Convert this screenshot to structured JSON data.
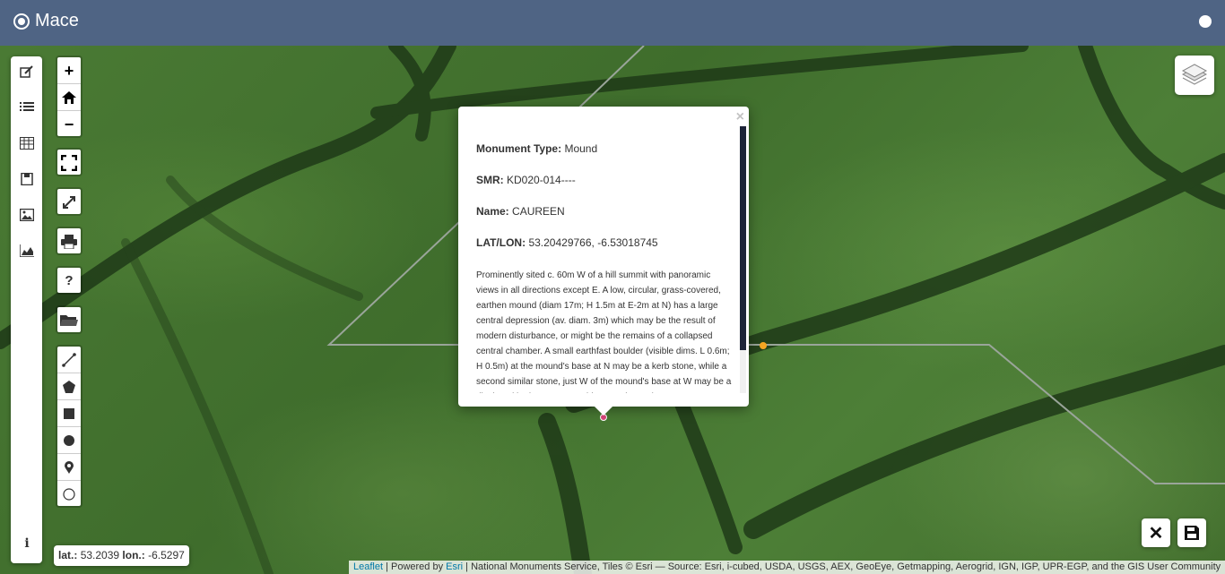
{
  "app": {
    "title": "Mace"
  },
  "header": {
    "github_icon": "github-icon"
  },
  "left_sidebar": {
    "items": [
      "edit-icon",
      "list-icon",
      "table-icon",
      "save-icon",
      "image-icon",
      "area-chart-icon"
    ],
    "info_icon": "info-icon",
    "info_label": "i"
  },
  "map_controls": {
    "zoom_in": "+",
    "zoom_home_icon": "home-icon",
    "zoom_out": "−",
    "fullscreen_icon": "fullscreen-icon",
    "expand_icon": "expand-icon",
    "print_icon": "print-icon",
    "help": "?",
    "open_folder_icon": "folder-icon",
    "draw_tools": [
      "polyline-icon",
      "polygon-icon",
      "rectangle-icon",
      "circle-icon",
      "marker-icon",
      "circle-marker-icon"
    ]
  },
  "layers_control": {
    "icon": "layers-icon"
  },
  "popup": {
    "close": "×",
    "monument_type_label": "Monument Type:",
    "monument_type_value": "Mound",
    "smr_label": "SMR:",
    "smr_value": "KD020-014----",
    "name_label": "Name:",
    "name_value": "CAUREEN",
    "latlon_label": "LAT/LON:",
    "latlon_value": "53.20429766, -6.53018745",
    "description": "Prominently sited c. 60m W of a hill summit with panoramic views in all directions except E. A low, circular, grass-covered, earthen mound (diam 17m; H 1.5m at E-2m at N) has a large central depression (av. diam. 3m) which may be the result of modern disturbance, or might be the remains of a collapsed central chamber. A small earthfast boulder (visible dims. L 0.6m; H 0.5m) at the mound's base at N may be a kerb stone, while a second similar stone, just W of the mound's base at W may be a displaced kerbstone. Low whin cover is starting to"
  },
  "coords": {
    "lat_label": "lat.:",
    "lat_value": "53.2039",
    "lon_label": "lon.:",
    "lon_value": "-6.5297"
  },
  "attribution": {
    "leaflet": "Leaflet",
    "sep1": " | Powered by ",
    "esri": "Esri",
    "rest": " | National Monuments Service, Tiles © Esri — Source: Esri, i-cubed, USDA, USGS, AEX, GeoEye, Getmapping, Aerogrid, IGN, IGP, UPR-EGP, and the GIS User Community"
  },
  "actions": {
    "cancel": "✕",
    "save_icon": "save-icon"
  },
  "colors": {
    "navbar": "#4f6484",
    "marker_orange": "#f5a623",
    "marker_pink": "#d9467a",
    "scroll_thumb": "#1d2438"
  }
}
